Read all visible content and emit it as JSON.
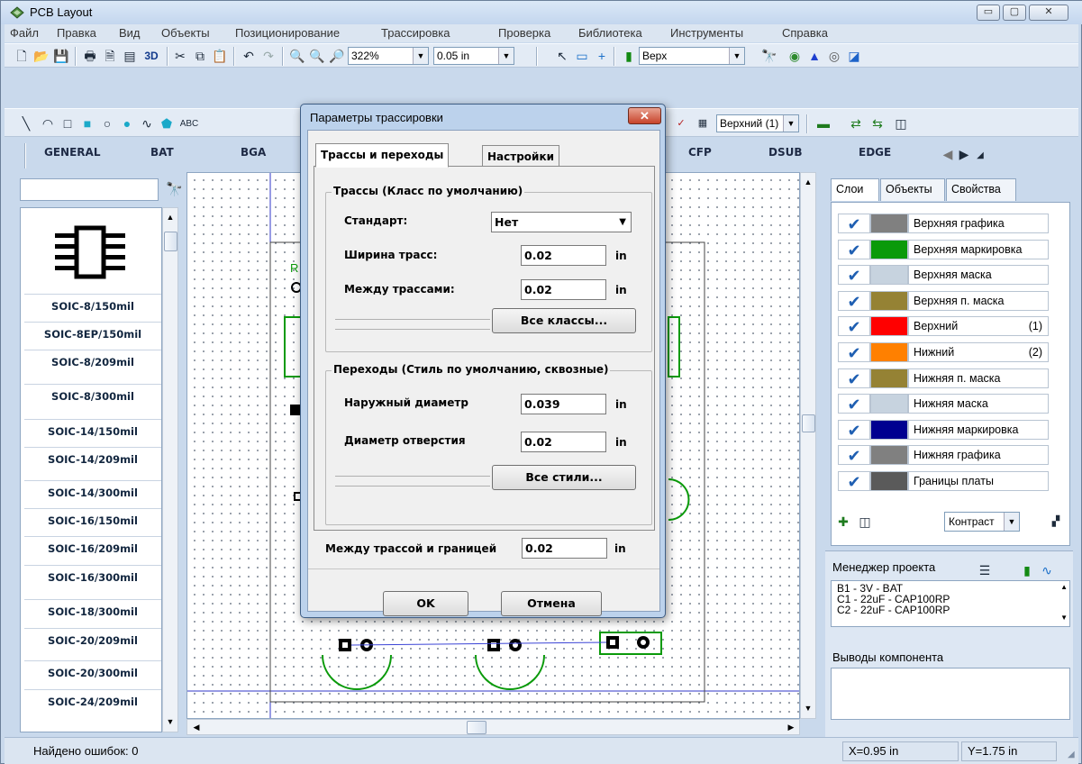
{
  "window": {
    "title": "PCB Layout",
    "minimize": "▭",
    "maximize": "▢",
    "close": "✕"
  },
  "menu": [
    "Файл",
    "Правка",
    "Вид",
    "Объекты",
    "Позиционирование",
    "Трассировка",
    "Проверка",
    "Библиотека",
    "Инструменты",
    "Справка"
  ],
  "toolbar1": {
    "three_d": "3D",
    "zoom": "322%",
    "grid": "0.05 in",
    "layer_select": "Верх"
  },
  "toolbar2": {
    "text_tool": "ABC",
    "layer_select": "Верхний (1)"
  },
  "categories": [
    "GENERAL",
    "BAT",
    "BGA",
    "CFP",
    "DSUB",
    "EDGE"
  ],
  "library": {
    "search_value": "",
    "items": [
      "SOIC-8/150mil",
      "SOIC-8EP/150mil",
      "SOIC-8/209mil",
      "SOIC-8/300mil",
      "SOIC-14/150mil",
      "SOIC-14/209mil",
      "SOIC-14/300mil",
      "SOIC-16/150mil",
      "SOIC-16/209mil",
      "SOIC-16/300mil",
      "SOIC-18/300mil",
      "SOIC-20/209mil",
      "SOIC-20/300mil",
      "SOIC-24/209mil"
    ]
  },
  "right_tabs": [
    "Слои",
    "Объекты",
    "Свойства"
  ],
  "layers": [
    {
      "name": "Верхняя графика",
      "color": "#808080",
      "num": ""
    },
    {
      "name": "Верхняя маркировка",
      "color": "#0a9a0a",
      "num": ""
    },
    {
      "name": "Верхняя маска",
      "color": "#c7d3df",
      "num": ""
    },
    {
      "name": "Верхняя п. маска",
      "color": "#958234",
      "num": ""
    },
    {
      "name": "Верхний",
      "color": "#ff0000",
      "num": "(1)"
    },
    {
      "name": "Нижний",
      "color": "#ff8000",
      "num": "(2)"
    },
    {
      "name": "Нижняя п. маска",
      "color": "#958234",
      "num": ""
    },
    {
      "name": "Нижняя маска",
      "color": "#c7d3df",
      "num": ""
    },
    {
      "name": "Нижняя маркировка",
      "color": "#000090",
      "num": ""
    },
    {
      "name": "Нижняя графика",
      "color": "#808080",
      "num": ""
    },
    {
      "name": "Границы платы",
      "color": "#5a5a5a",
      "num": ""
    }
  ],
  "contrast": "Контраст",
  "project": {
    "title": "Менеджер проекта",
    "items": [
      "B1 - 3V - BAT",
      "C1 - 22uF - CAP100RP",
      "C2 - 22uF - CAP100RP"
    ],
    "pins_title": "Выводы компонента"
  },
  "status": {
    "errors": "Найдено ошибок: 0",
    "x": "X=0.95 in",
    "y": "Y=1.75 in"
  },
  "canvas": {
    "ref_label": "R"
  },
  "dialog": {
    "title": "Параметры трассировки",
    "tabs": [
      "Трассы и переходы",
      "Настройки"
    ],
    "traces_group": "Трассы (Класс по умолчанию)",
    "standard_label": "Стандарт:",
    "standard_value": "Нет",
    "width_label": "Ширина трасс:",
    "width_value": "0.02",
    "clearance_label": "Между трассами:",
    "clearance_value": "0.02",
    "all_classes": "Все классы...",
    "vias_group": "Переходы (Стиль по умолчанию, сквозные)",
    "outer_label": "Наружный диаметр",
    "outer_value": "0.039",
    "hole_label": "Диаметр отверстия",
    "hole_value": "0.02",
    "all_styles": "Все стили...",
    "edge_label": "Между трассой и границей",
    "edge_value": "0.02",
    "unit": "in",
    "ok": "OK",
    "cancel": "Отмена"
  }
}
